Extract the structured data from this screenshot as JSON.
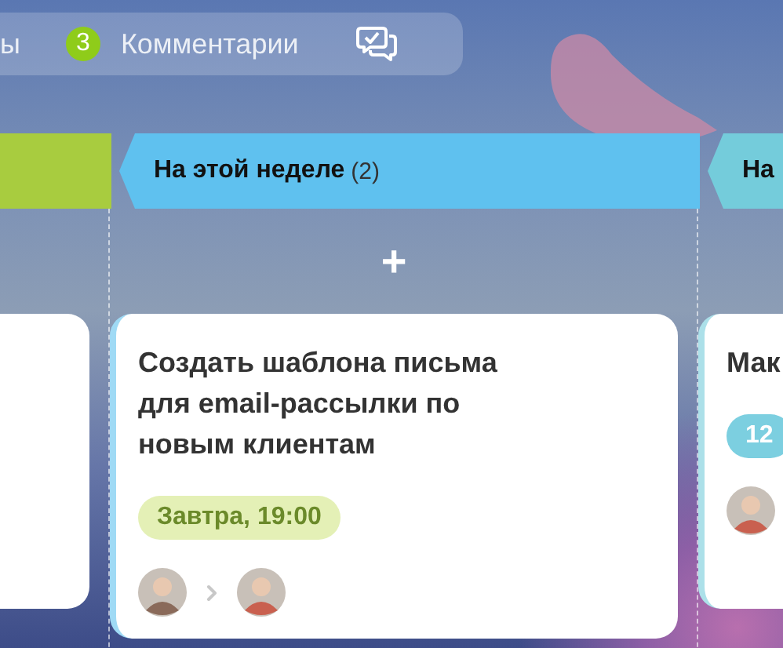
{
  "tab_bar": {
    "cut_tab": {
      "label": "ы",
      "selected": false
    },
    "comments": {
      "count": "3",
      "label": "Комментарии",
      "selected": false
    }
  },
  "columns": [
    {
      "color": "#a8cc3f",
      "cards": [
        {
          "kind": "blank"
        }
      ]
    },
    {
      "title": "На этой неделе",
      "count": "(2)",
      "color": "#5fc1ef",
      "add_label": "+",
      "cards": [
        {
          "kind": "task",
          "title": "Создать шаблона письма для email-рассылки по новым клиентам",
          "deadline": {
            "text": "Завтра, 19:00",
            "color": "#e4f0b6",
            "kind": "soon"
          },
          "people": [
            {
              "kind": "creator"
            },
            {
              "kind": "responsible"
            }
          ]
        }
      ]
    },
    {
      "title": "На",
      "color": "#74ccdb",
      "cards": [
        {
          "kind": "task",
          "title": "Мак",
          "deadline": {
            "text": "12",
            "color": "#7ccfe0",
            "kind": "later"
          },
          "people": [
            {
              "kind": "responsible"
            }
          ]
        }
      ]
    }
  ]
}
